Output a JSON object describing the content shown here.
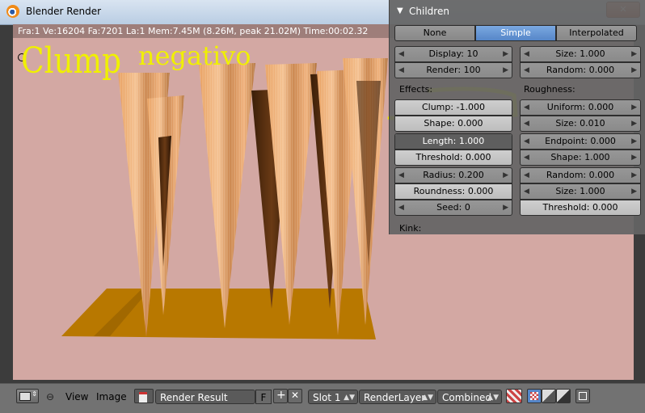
{
  "window": {
    "title": "Blender Render",
    "close_glyph": "✕"
  },
  "render": {
    "stats": "Fra:1  Ve:16204 Fa:7201 La:1 Mem:7.45M (8.26M, peak 21.02M) Time:00:02.32",
    "annotation_left": "Clump",
    "annotation_right": "negativo",
    "background_color": "#d3a8a3",
    "annotation_color": "#f0f000"
  },
  "panel": {
    "title": "Children",
    "modes": [
      "None",
      "Simple",
      "Interpolated"
    ],
    "selected_mode": "Simple",
    "display_label": "Display: 10",
    "render_label": "Render: 100",
    "size_label": "Size: 1.000",
    "random_label": "Random: 0.000",
    "effects_label": "Effects:",
    "roughness_label": "Roughness:",
    "clump_label": "Clump: -1.000",
    "shape_label": "Shape: 0.000",
    "uniform_label": "Uniform: 0.000",
    "uniform_size_label": "Size: 0.010",
    "length_label": "Length: 1.000",
    "threshold_label": "Threshold: 0.000",
    "endpoint_label": "Endpoint: 0.000",
    "endpoint_shape_label": "Shape: 1.000",
    "radius_label": "Radius: 0.200",
    "roundness_label": "Roundness: 0.000",
    "seed_label": "Seed: 0",
    "rough_random_label": "Random: 0.000",
    "rough_size_label": "Size: 1.000",
    "rough_threshold_label": "Threshold: 0.000",
    "kink_label": "Kink:"
  },
  "bottom": {
    "view_menu": "View",
    "image_menu": "Image",
    "image_name": "Render Result",
    "fake_user": "F",
    "slot": "Slot 1",
    "layer": "RenderLayer",
    "pass": "Combined"
  }
}
